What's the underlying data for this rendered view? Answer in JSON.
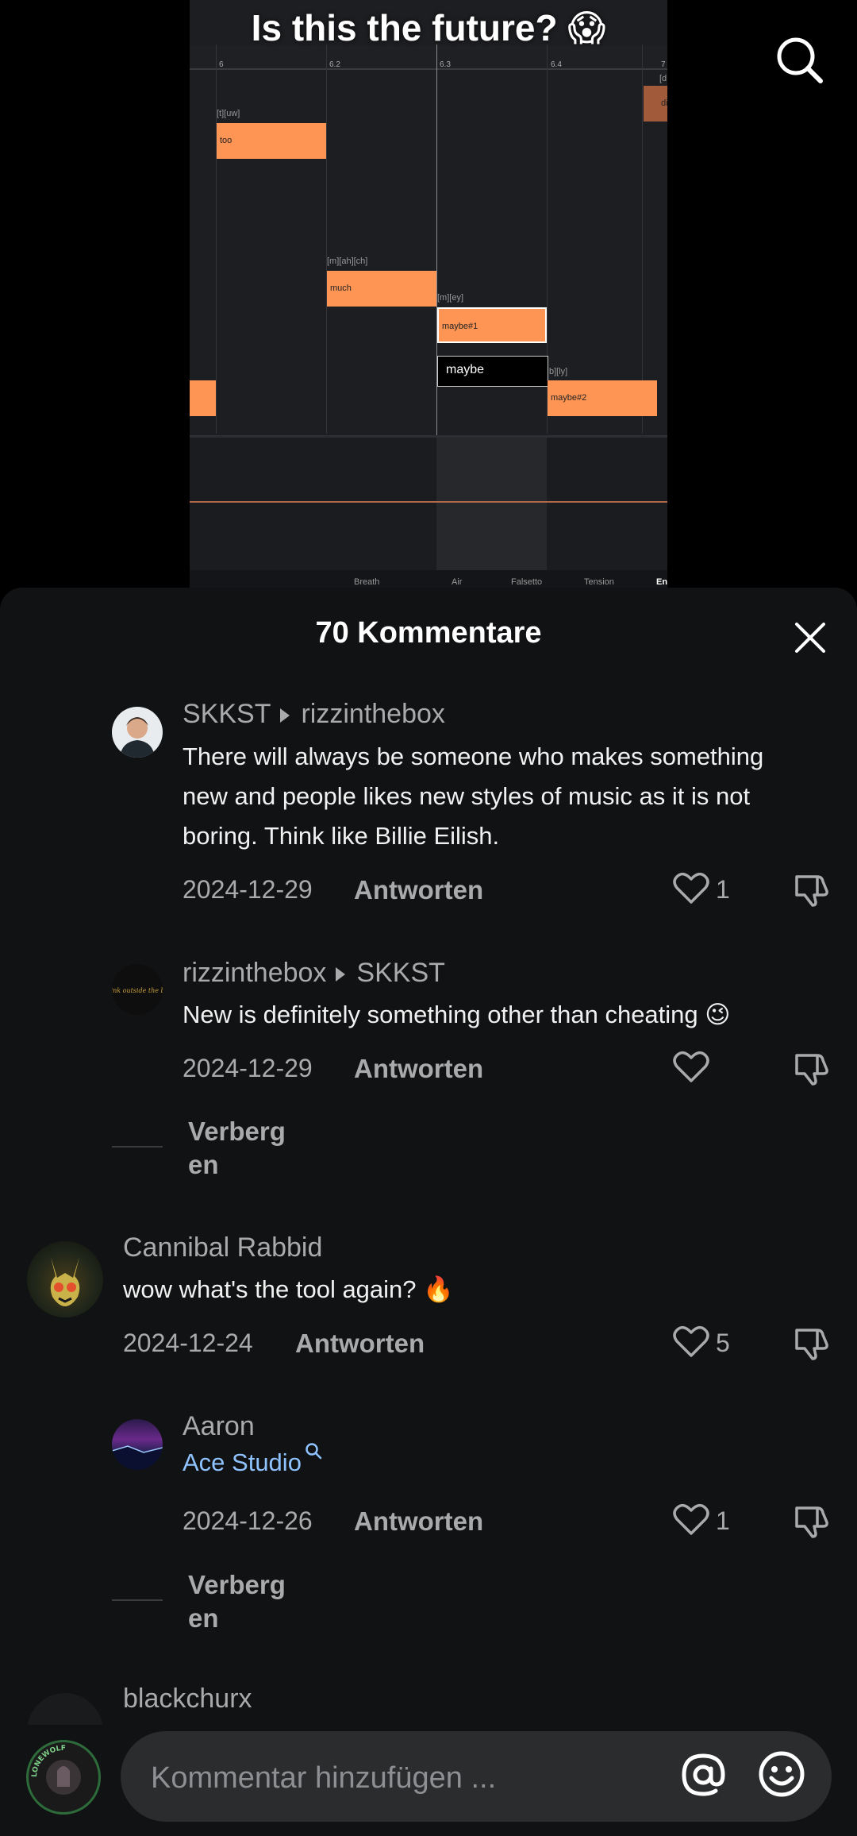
{
  "video": {
    "title": "Is this the future? 😱",
    "ruler_ticks": [
      "6",
      "6.2",
      "6.3",
      "6.4",
      "7"
    ],
    "notes": [
      "too",
      "much",
      "maybe#1",
      "maybe",
      "maybe#2",
      "di"
    ],
    "phonemes": [
      "[t][uw]",
      "[m][ah][ch]",
      "[m][ey]",
      "b][ly]",
      "[d"
    ],
    "param_labels": [
      "Breath",
      "Air",
      "Falsetto",
      "Tension",
      "En"
    ]
  },
  "top": {
    "search_icon": "search-icon"
  },
  "comments_header": {
    "title": "70 Kommentare",
    "close_icon": "close-icon"
  },
  "comments": [
    {
      "user": "SKKST",
      "reply_to": "rizzinthebox",
      "text": "There will always be someone who makes something new and people likes new styles of music as it is not boring. Think like Billie Eilish.",
      "date": "2024-12-29",
      "reply_label": "Antworten",
      "likes": "1"
    },
    {
      "user": "rizzinthebox",
      "reply_to": "SKKST",
      "avatar_text": "Think outside the box",
      "text": "New is definitely something other than cheating 😉",
      "date": "2024-12-29",
      "reply_label": "Antworten",
      "likes": ""
    },
    {
      "user": "Cannibal Rabbid",
      "text": "wow what's the tool again? 🔥",
      "date": "2024-12-24",
      "reply_label": "Antworten",
      "likes": "5"
    },
    {
      "user": "Aaron",
      "link_text": "Ace Studio",
      "date": "2024-12-26",
      "reply_label": "Antworten",
      "likes": "1"
    },
    {
      "user": "blackchurx"
    }
  ],
  "hide_replies_label": "Verbergen",
  "hide_replies_lines": [
    "Verberg",
    "en"
  ],
  "input": {
    "placeholder": "Kommentar hinzufügen ...",
    "mention_icon": "at-icon",
    "emoji_icon": "emoji-icon",
    "avatar_text": "LONEWOLF"
  },
  "colors": {
    "sheet_bg": "#111213",
    "note_orange": "#ff9555",
    "link_blue": "#8fc3ff",
    "muted_text": "#a9aaac"
  }
}
